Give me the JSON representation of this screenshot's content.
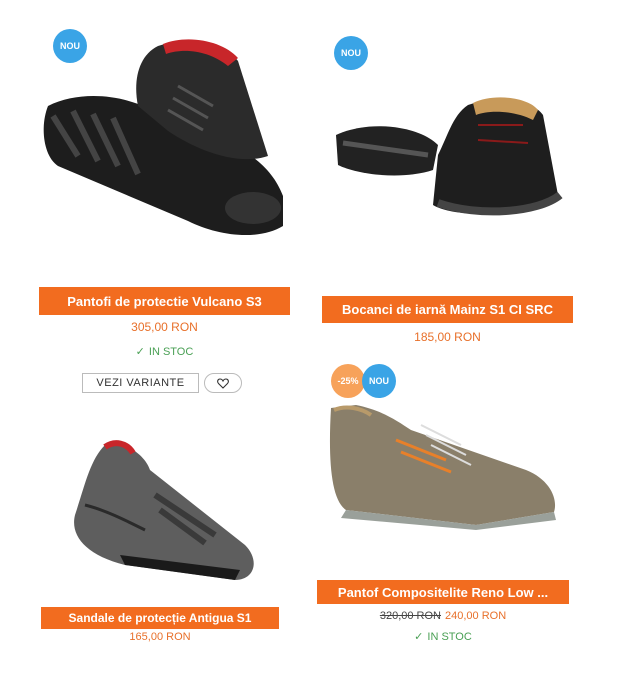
{
  "products": [
    {
      "name": "Pantofi de protectie Vulcano S3",
      "badges": [
        "NOU"
      ],
      "price": "305,00 RON",
      "stock": "IN STOC",
      "actions": {
        "variants": "VEZI VARIANTE",
        "wishlist_icon": "heart-icon"
      }
    },
    {
      "name": "Bocanci de iarnă Mainz S1 CI SRC",
      "badges": [
        "NOU"
      ],
      "price": "185,00 RON"
    },
    {
      "name": "Sandale de protecție Antigua S1",
      "badges": [],
      "price": "165,00 RON"
    },
    {
      "name": "Pantof Compositelite Reno Low ...",
      "badges": [
        "-25%",
        "NOU"
      ],
      "old_price": "320,00 RON",
      "price": "240,00 RON",
      "stock": "IN STOC"
    }
  ],
  "colors": {
    "accent": "#f26c1f",
    "price": "#e8702a",
    "badge_new": "#3aa4e6",
    "badge_sale": "#f7a25a",
    "in_stock": "#4aa055"
  }
}
